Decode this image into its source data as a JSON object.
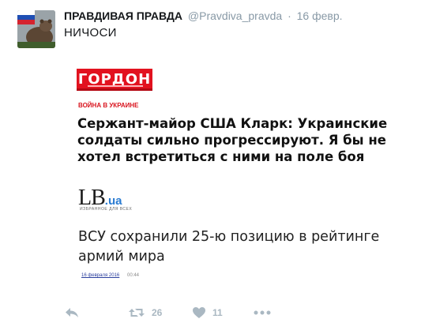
{
  "tweet": {
    "author_name": "ПРАВДИВАЯ ПРАВДА",
    "handle": "@Pravdiva_pravda",
    "separator": "·",
    "date": "16 февр.",
    "text": "НИЧОСИ"
  },
  "media": {
    "gordon_logo": "ГОРДОН",
    "section_label": "ВОЙНА В УКРАИНЕ",
    "headline_1": "Сержант-майор США Кларк: Украинские солдаты сильно прогрессируют. Я бы не хотел встретиться с ними на поле боя",
    "lb_logo_main": "LB",
    "lb_logo_suffix": ".ua",
    "lb_tagline": "ИЗБРАННОЕ ДЛЯ ВСЕХ",
    "headline_2": "ВСУ сохранили 25-ю позицию в рейтинге армий мира",
    "article_date": "16 февраля 2016",
    "article_time": "00:44"
  },
  "actions": {
    "reply_icon": "reply-icon",
    "retweet_icon": "retweet-icon",
    "retweet_count": "26",
    "like_icon": "heart-icon",
    "like_count": "11",
    "more_icon": "more-icon"
  },
  "colors": {
    "gordon_red": "#e2121f",
    "lb_blue": "#2a7bd1",
    "muted_gray": "#8899a6",
    "action_gray": "#aab8c2"
  }
}
